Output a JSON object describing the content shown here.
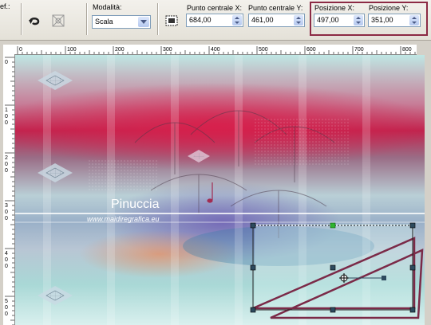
{
  "toolbar": {
    "partial_label": "ef.:",
    "mode_label": "Modalità:",
    "mode_value": "Scala",
    "center_x_label": "Punto centrale X:",
    "center_x_value": "684,00",
    "center_y_label": "Punto centrale Y:",
    "center_y_value": "461,00",
    "pos_x_label": "Posizione X:",
    "pos_x_value": "497,00",
    "pos_y_label": "Posizione Y:",
    "pos_y_value": "351,00"
  },
  "icons": {
    "undo": "undo-arrow-icon",
    "reset": "reset-icon",
    "grid": "grid-select-icon"
  },
  "ruler_h": {
    "labels": [
      "0",
      "100",
      "200",
      "300",
      "400",
      "500",
      "600",
      "700",
      "800"
    ]
  },
  "ruler_v": {
    "labels": [
      "0",
      "1\n0\n0",
      "2\n0\n0",
      "3\n0\n0",
      "4\n0\n0",
      "5\n0\n0"
    ]
  },
  "watermark": {
    "title": "Pinuccia",
    "url": "www.maidiregrafica.eu"
  },
  "colors": {
    "highlight": "#8c2a44",
    "handle_center": "#2fb52f",
    "deform_line": "#7b2a48"
  }
}
